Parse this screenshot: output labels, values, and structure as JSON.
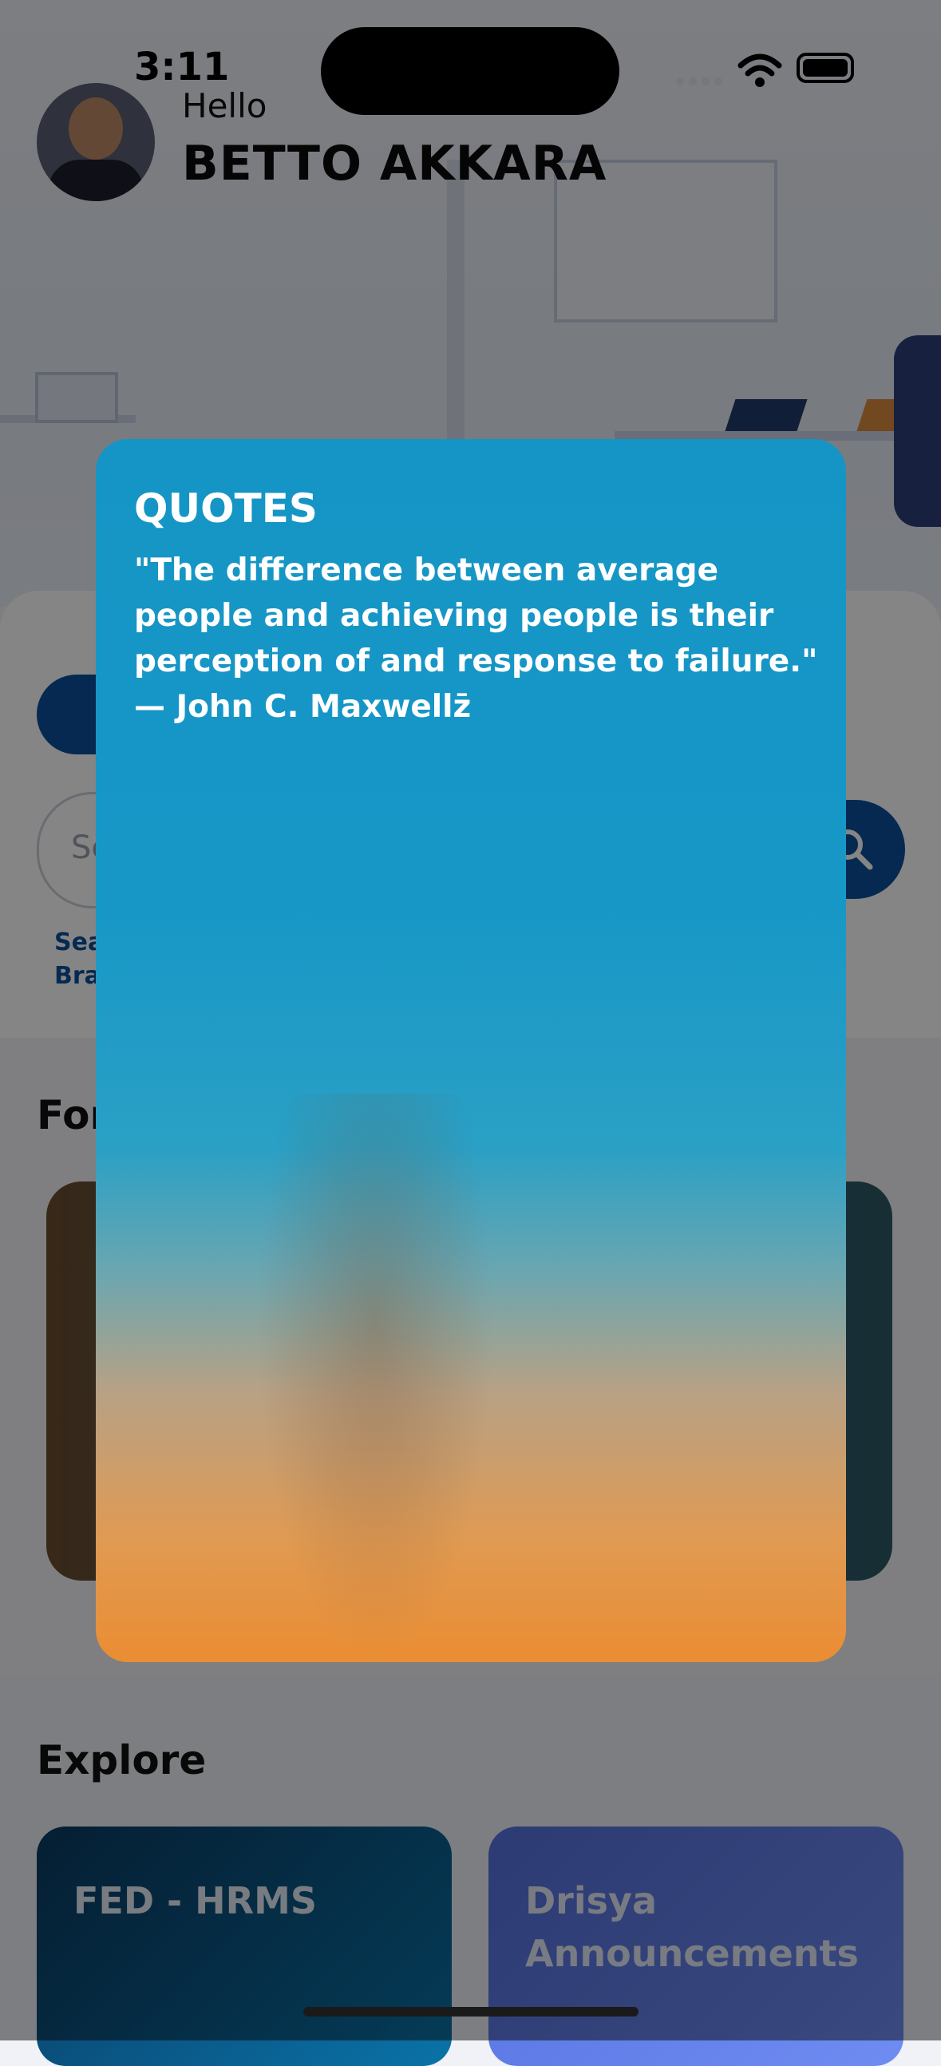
{
  "status_bar": {
    "time": "3:11"
  },
  "header": {
    "greeting": "Hello",
    "user_name": "BETTO AKKARA"
  },
  "search": {
    "placeholder": "Se",
    "helper_text_line1": "Sea",
    "helper_text_line2": "Bra"
  },
  "sections": {
    "featured_title": "For",
    "explore_title": "Explore"
  },
  "explore_tiles": [
    {
      "label": "FED - HRMS"
    },
    {
      "label": "Drisya Announcements"
    }
  ],
  "modal": {
    "title": "QUOTES",
    "quote": "\"The difference between average people and achieving people is their perception of and response to failure.\" — John C. Maxwellz̄"
  },
  "colors": {
    "brand_blue": "#0b4f9a",
    "modal_blue": "#1595c5",
    "sunset_orange": "#ea8d33"
  }
}
